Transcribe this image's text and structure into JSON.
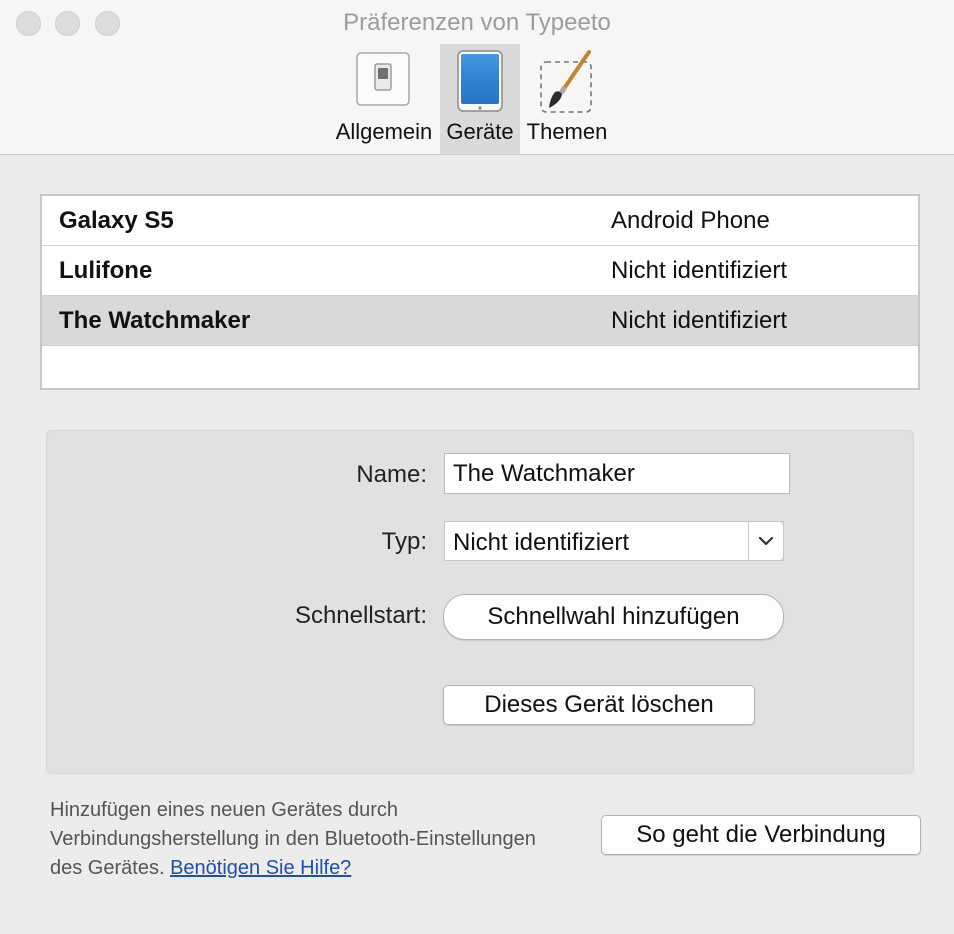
{
  "window": {
    "title": "Präferenzen von Typeeto"
  },
  "toolbar": {
    "tabs": [
      {
        "label": "Allgemein",
        "icon": "switch-icon"
      },
      {
        "label": "Geräte",
        "icon": "tablet-icon",
        "active": true
      },
      {
        "label": "Themen",
        "icon": "paintbrush-icon"
      }
    ]
  },
  "devices": [
    {
      "name": "Galaxy S5",
      "type": "Android Phone"
    },
    {
      "name": "Lulifone",
      "type": "Nicht identifiziert"
    },
    {
      "name": "The Watchmaker",
      "type": "Nicht identifiziert",
      "selected": true
    }
  ],
  "detail": {
    "name_label": "Name:",
    "name_value": "The Watchmaker",
    "type_label": "Typ:",
    "type_value": "Nicht identifiziert",
    "quickstart_label": "Schnellstart:",
    "quickstart_button": "Schnellwahl hinzufügen",
    "delete_button": "Dieses Gerät löschen"
  },
  "footer": {
    "help_text_line1": "Hinzufügen eines neuen Gerätes durch",
    "help_text_line2": "Verbindungsherstellung in den Bluetooth-Einstellungen",
    "help_text_line3": "des Gerätes.",
    "help_link": "Benötigen Sie Hilfe?",
    "connect_button": "So geht die Verbindung"
  },
  "colors": {
    "link": "#1f4fa8",
    "selected_row": "#d9d9d9",
    "active_tab": "#dadada"
  }
}
